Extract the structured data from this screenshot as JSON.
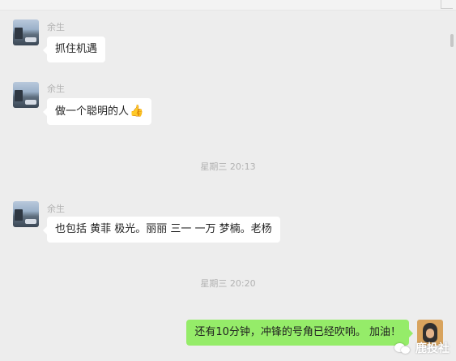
{
  "sender": {
    "name": "余生"
  },
  "messages": [
    {
      "text": "抓住机遇"
    },
    {
      "text": "做一个聪明的人",
      "emoji": "👍"
    }
  ],
  "timestamps": [
    "星期三 20:13",
    "星期三 20:20"
  ],
  "message_3": {
    "text": "也包括 黄菲  极光。丽丽 三一 一万  梦楠。老杨"
  },
  "my_message": {
    "text": "还有10分钟，冲锋的号角已经吹响。 加油！"
  },
  "watermark": {
    "text": "鹿投社",
    "logo": "wechat-logo-icon"
  },
  "colors": {
    "background": "#ededed",
    "bubble_left": "#ffffff",
    "bubble_right": "#95ec69",
    "muted_text": "#b2b2b2"
  }
}
